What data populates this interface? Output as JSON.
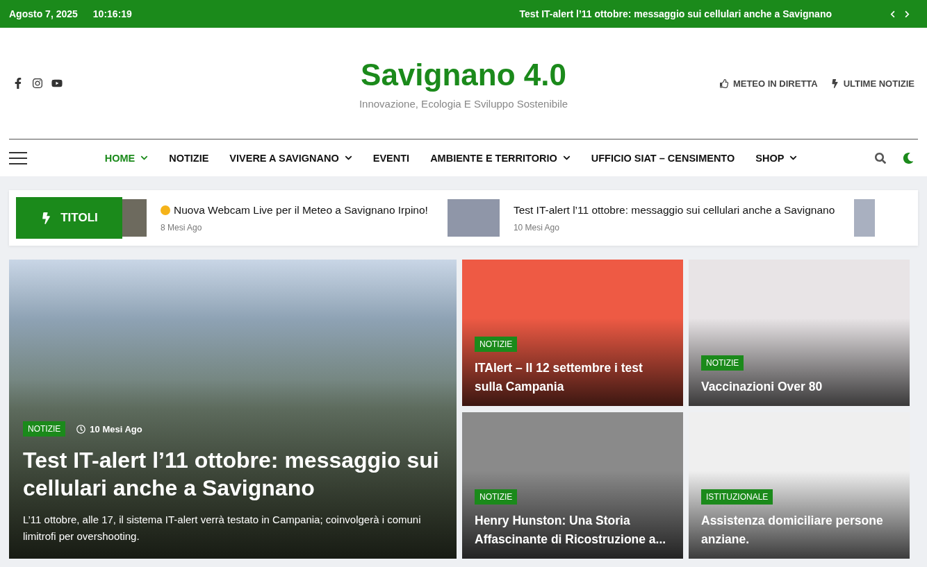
{
  "top_bar": {
    "date": "Agosto 7, 2025",
    "time": "10:16:19",
    "headline": "Test IT-alert l’11 ottobre: messaggio sui cellulari anche a Savignano"
  },
  "header": {
    "title": "Savignano 4.0",
    "tagline": "Innovazione, Ecologia E Sviluppo Sostenibile",
    "links": [
      {
        "kind": "thumb",
        "label": "METEO IN DIRETTA"
      },
      {
        "kind": "bolt",
        "label": "ULTIME NOTIZIE"
      }
    ]
  },
  "nav": {
    "items": [
      {
        "label": "HOME",
        "selected": true,
        "has_submenu": true
      },
      {
        "label": "NOTIZIE",
        "selected": false,
        "has_submenu": false
      },
      {
        "label": "VIVERE A SAVIGNANO",
        "selected": false,
        "has_submenu": true
      },
      {
        "label": "EVENTI",
        "selected": false,
        "has_submenu": false
      },
      {
        "label": "AMBIENTE E TERRITORIO",
        "selected": false,
        "has_submenu": true
      },
      {
        "label": "UFFICIO SIAT – CENSIMENTO",
        "selected": false,
        "has_submenu": false
      },
      {
        "label": "SHOP",
        "selected": false,
        "has_submenu": true
      }
    ]
  },
  "ticker": {
    "label": "TITOLI",
    "items": [
      {
        "title": "Nuova Webcam Live per il Meteo a Savignano Irpino!",
        "time": "8 Mesi Ago",
        "sun": true
      },
      {
        "title": "Test IT-alert l’11 ottobre: messaggio sui cellulari anche a Savignano",
        "time": "10 Mesi Ago",
        "sun": false
      }
    ]
  },
  "featured": {
    "category": "NOTIZIE",
    "time": "10 Mesi Ago",
    "title": "Test IT-alert l’11 ottobre: messaggio sui cellulari anche a Savignano",
    "excerpt": "L’11 ottobre, alle 17, il sistema IT-alert verrà testato in Campania; coinvolgerà i comuni limitrofi per overshooting."
  },
  "cards": [
    {
      "category": "NOTIZIE",
      "title": "ITAlert – Il 12 settembre i test sulla Campania",
      "color": "#ee5a44"
    },
    {
      "category": "NOTIZIE",
      "title": "Vaccinazioni Over 80",
      "color": "#e8e4e6"
    },
    {
      "category": "NOTIZIE",
      "title": "Henry Hunston: Una Storia Affascinante di Ricostruzione a...",
      "color": "#8a8a8a"
    },
    {
      "category": "ISTITUZIONALE",
      "title": "Assistenza domiciliare persone anziane.",
      "color": "#efefef"
    }
  ]
}
